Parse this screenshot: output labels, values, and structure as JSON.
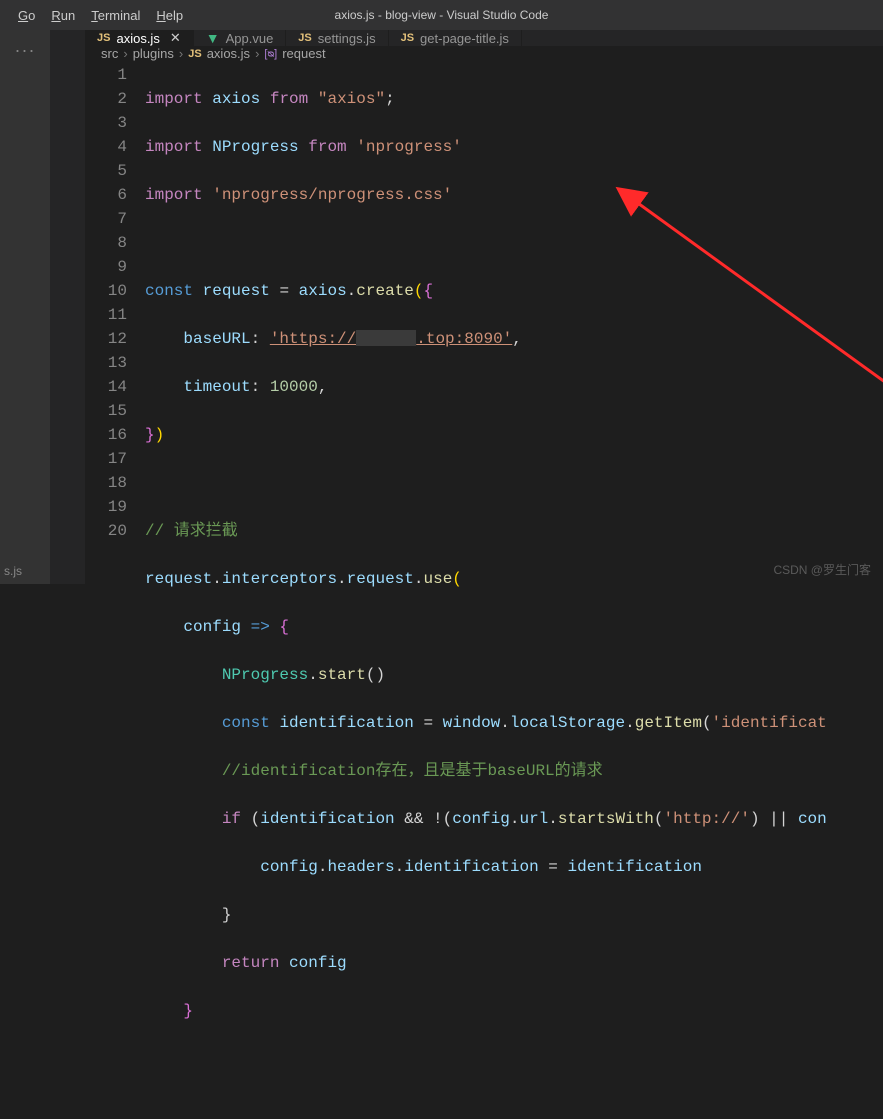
{
  "window": {
    "title": "axios.js - blog-view - Visual Studio Code"
  },
  "menu": {
    "items": [
      {
        "label": "Go",
        "mnemonic": "G",
        "rest": "o"
      },
      {
        "label": "Run",
        "mnemonic": "R",
        "rest": "un"
      },
      {
        "label": "Terminal",
        "mnemonic": "T",
        "rest": "erminal"
      },
      {
        "label": "Help",
        "mnemonic": "H",
        "rest": "elp"
      }
    ]
  },
  "tabs": [
    {
      "icon": "JS",
      "iconType": "js",
      "label": "axios.js",
      "active": true,
      "closable": true
    },
    {
      "icon": "▼",
      "iconType": "vue",
      "label": "App.vue",
      "active": false
    },
    {
      "icon": "JS",
      "iconType": "js",
      "label": "settings.js",
      "active": false
    },
    {
      "icon": "JS",
      "iconType": "js",
      "label": "get-page-title.js",
      "active": false
    }
  ],
  "breadcrumbs": {
    "parts": [
      "src",
      "plugins"
    ],
    "file": {
      "icon": "JS",
      "label": "axios.js"
    },
    "symbol": {
      "icon": "[ᴓ]",
      "label": "request"
    }
  },
  "activity": {
    "more": "···"
  },
  "sidebar": {
    "bottom_label": "s.js"
  },
  "gutter": [
    "1",
    "2",
    "3",
    "4",
    "5",
    "6",
    "7",
    "8",
    "9",
    "10",
    "11",
    "12",
    "13",
    "14",
    "15",
    "16",
    "17",
    "18",
    "19",
    "20"
  ],
  "code": {
    "l1": {
      "a": "import",
      "b": "axios",
      "c": "from",
      "d": "\"axios\"",
      "e": ";"
    },
    "l2": {
      "a": "import",
      "b": "NProgress",
      "c": "from",
      "d": "'nprogress'"
    },
    "l3": {
      "a": "import",
      "b": "'nprogress/nprogress.css'"
    },
    "l5": {
      "a": "const",
      "b": "request",
      "c": " = ",
      "d": "axios",
      "e": ".",
      "f": "create",
      "g": "(",
      "h": "{"
    },
    "l6": {
      "pad": "    ",
      "a": "baseURL",
      "b": ": ",
      "c": "'https://",
      "d": ".top:8090'",
      "e": ","
    },
    "l7": {
      "pad": "    ",
      "a": "timeout",
      "b": ": ",
      "c": "10000",
      "d": ","
    },
    "l8": {
      "a": "}",
      "b": ")"
    },
    "l10": {
      "a": "// 请求拦截"
    },
    "l11": {
      "a": "request",
      "b": ".",
      "c": "interceptors",
      "d": ".",
      "e": "request",
      "f": ".",
      "g": "use",
      "h": "("
    },
    "l12": {
      "pad": "    ",
      "a": "config",
      "b": " => ",
      "c": "{"
    },
    "l13": {
      "pad": "        ",
      "a": "NProgress",
      "b": ".",
      "c": "start",
      "d": "()"
    },
    "l14": {
      "pad": "        ",
      "a": "const",
      "b": " ",
      "c": "identification",
      "d": " = ",
      "e": "window",
      "f": ".",
      "g": "localStorage",
      "h": ".",
      "i": "getItem",
      "j": "(",
      "k": "'identificat"
    },
    "l15": {
      "pad": "        ",
      "a": "//identification存在，且是基于baseURL的请求"
    },
    "l16": {
      "pad": "        ",
      "a": "if",
      "b": " (",
      "c": "identification",
      "d": " && !(",
      "e": "config",
      "f": ".",
      "g": "url",
      "h": ".",
      "i": "startsWith",
      "j": "(",
      "k": "'http://'",
      "l": ") || ",
      "m": "con"
    },
    "l17": {
      "pad": "            ",
      "a": "config",
      "b": ".",
      "c": "headers",
      "d": ".",
      "e": "identification",
      "f": " = ",
      "g": "identification"
    },
    "l18": {
      "pad": "        ",
      "a": "}"
    },
    "l19": {
      "pad": "        ",
      "a": "return",
      "b": " ",
      "c": "config"
    },
    "l20": {
      "pad": "    ",
      "a": "}"
    }
  },
  "watermark": "CSDN @罗生门客"
}
